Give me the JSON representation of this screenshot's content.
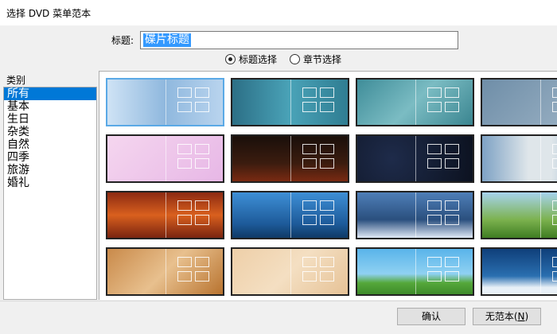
{
  "window": {
    "title": "选择 DVD 菜单范本"
  },
  "header": {
    "title_label": "标题:",
    "title_value": "碟片标题"
  },
  "options": {
    "title_select": "标题选择",
    "chapter_select": "章节选择",
    "selected": "title_select"
  },
  "categories": {
    "label": "类别",
    "items": [
      "所有",
      "基本",
      "生日",
      "杂类",
      "自然",
      "四季",
      "旅游",
      "婚礼"
    ],
    "selected_index": 0
  },
  "gallery": {
    "selected_index": 0,
    "thumbnails": [
      {
        "name": "template-blue-gradient",
        "bg": "linear-gradient(90deg,#cfe3f5,#8fb8de 50%,#b9d4ee)"
      },
      {
        "name": "template-teal-lines",
        "bg": "linear-gradient(90deg,#2c6f86,#4aa3b8 50%,#2f7d92)"
      },
      {
        "name": "template-teal-circles",
        "bg": "linear-gradient(135deg,#3f8d99,#7bbcc3 50%,#3a8590)"
      },
      {
        "name": "template-grey-blue",
        "bg": "linear-gradient(135deg,#6f8ea8,#9fb5c7)"
      },
      {
        "name": "template-birthday-balloons",
        "bg": "linear-gradient(135deg,#f5d6ef,#e7b7e6)"
      },
      {
        "name": "template-birthday-cake",
        "bg": "linear-gradient(180deg,#1a0f0a,#3b1c0f 60%,#7a2a12)"
      },
      {
        "name": "template-dark-rings",
        "bg": "radial-gradient(circle at 30% 50%,#1e2b4a,#0c1220)"
      },
      {
        "name": "template-penguin",
        "bg": "linear-gradient(90deg,#7ea2c4,#dfe6ea 40%,#dfe6ea 60%,#7ea2c4)"
      },
      {
        "name": "template-sunset-clouds",
        "bg": "linear-gradient(180deg,#8c2a12,#d9601e 50%,#7a2410)"
      },
      {
        "name": "template-blue-forest",
        "bg": "linear-gradient(180deg,#3e8fd6,#1d5a99 70%,#0f3a66)"
      },
      {
        "name": "template-snow-forest",
        "bg": "linear-gradient(180deg,#4f7fb8,#2a4f7e 60%,#dfe8f5)"
      },
      {
        "name": "template-spring-trees",
        "bg": "linear-gradient(180deg,#a7d3ee,#7cb24f 60%,#3f7d22)"
      },
      {
        "name": "template-autumn-pumpkin",
        "bg": "linear-gradient(135deg,#c98a4a,#e8c08e 50%,#b8732f)"
      },
      {
        "name": "template-beige-paper",
        "bg": "linear-gradient(135deg,#eecfa8,#f4dfc2 50%,#e6c296)"
      },
      {
        "name": "template-cartoon-tree",
        "bg": "linear-gradient(180deg,#59b4ea,#8fd1f2 55%,#55a83a 75%,#3d8a2a)"
      },
      {
        "name": "template-blue-waves",
        "bg": "linear-gradient(180deg,#0f3f7a,#2a6fb0 60%,#e8f0f7 85%)"
      }
    ]
  },
  "buttons": {
    "ok": "确认",
    "no_template_prefix": "无范本(",
    "no_template_key": "N",
    "no_template_suffix": ")"
  }
}
